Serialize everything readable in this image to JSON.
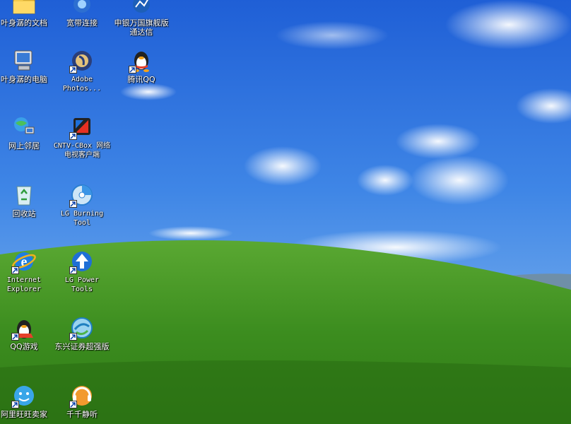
{
  "desktop": {
    "icons": [
      {
        "label": "叶身潺的文档"
      },
      {
        "label": "宽带连接"
      },
      {
        "label": "申银万国旗舰版通达信"
      },
      {
        "label": "叶身潺的电脑"
      },
      {
        "label": "Adobe Photos..."
      },
      {
        "label": "腾讯QQ"
      },
      {
        "label": "网上邻居"
      },
      {
        "label": "CNTV-CBox 网络电视客户端"
      },
      {
        "label": "回收站"
      },
      {
        "label": "LG Burning Tool"
      },
      {
        "label": "Internet Explorer"
      },
      {
        "label": "LG Power Tools"
      },
      {
        "label": "QQ游戏"
      },
      {
        "label": "东兴证券超强版"
      },
      {
        "label": "阿里旺旺卖家"
      },
      {
        "label": "千千静听"
      }
    ]
  }
}
